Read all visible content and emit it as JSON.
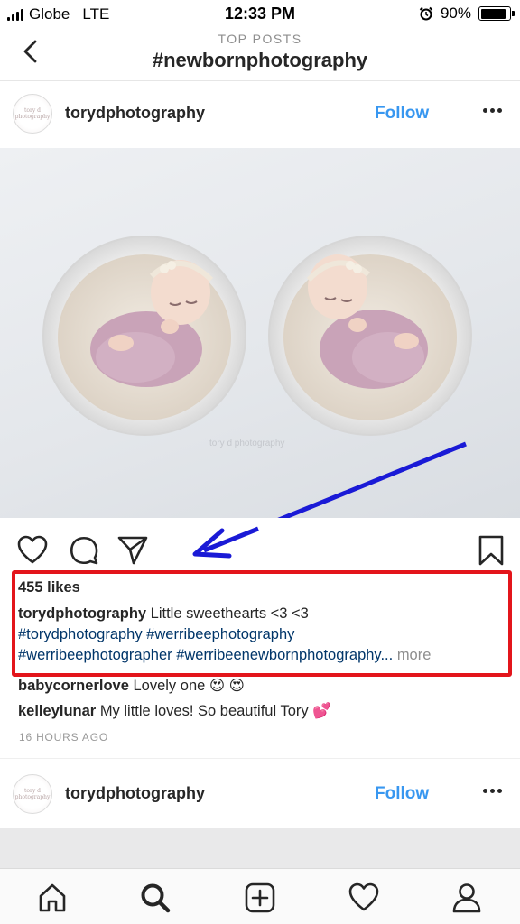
{
  "status_bar": {
    "carrier": "Globe",
    "network": "LTE",
    "time": "12:33 PM",
    "battery": "90%",
    "battery_level": 0.9
  },
  "header": {
    "subtitle": "TOP POSTS",
    "title": "#newbornphotography"
  },
  "post": {
    "avatar_text": "tory d photography",
    "username": "torydphotography",
    "follow_label": "Follow",
    "photo_watermark": "tory d photography",
    "likes": "455 likes",
    "caption_user": "torydphotography",
    "caption_text": "Little sweethearts <3 <3",
    "hashtags_line1": "#torydphotography #werribeephotography",
    "hashtags_line2": "#werribeephotographer #werribeenewbornphotography...",
    "more_label": "more",
    "comments": [
      {
        "user": "babycornerlove",
        "text": "Lovely one 😍 😍"
      },
      {
        "user": "kelleylunar",
        "text": "My little loves! So beautiful Tory 💕"
      }
    ],
    "time_ago": "16 HOURS AGO"
  },
  "post2": {
    "avatar_text": "tory d photography",
    "username": "torydphotography",
    "follow_label": "Follow"
  },
  "annotation_colors": {
    "arrow": "#1a1ad6",
    "box": "#e3151b"
  },
  "tabs": [
    "home-icon",
    "search-icon",
    "add-icon",
    "heart-icon",
    "profile-icon"
  ]
}
